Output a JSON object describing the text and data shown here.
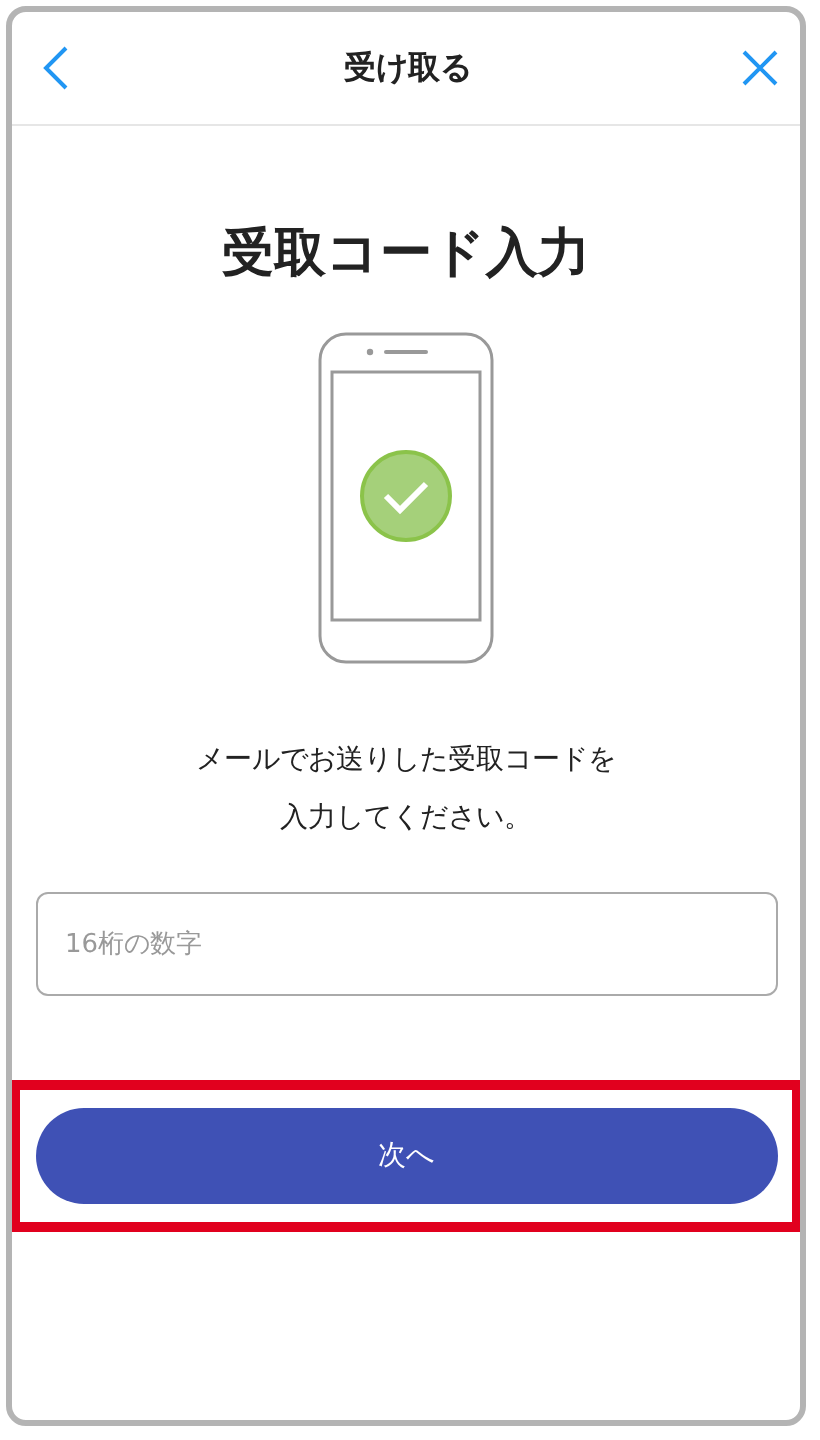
{
  "header": {
    "title": "受け取る"
  },
  "heading": "受取コード入力",
  "instructions": [
    "メールでお送りした受取コードを",
    "入力してください。"
  ],
  "code_field": {
    "placeholder": "16桁の数字"
  },
  "next_button": {
    "label": "次へ",
    "highlighted": true
  }
}
